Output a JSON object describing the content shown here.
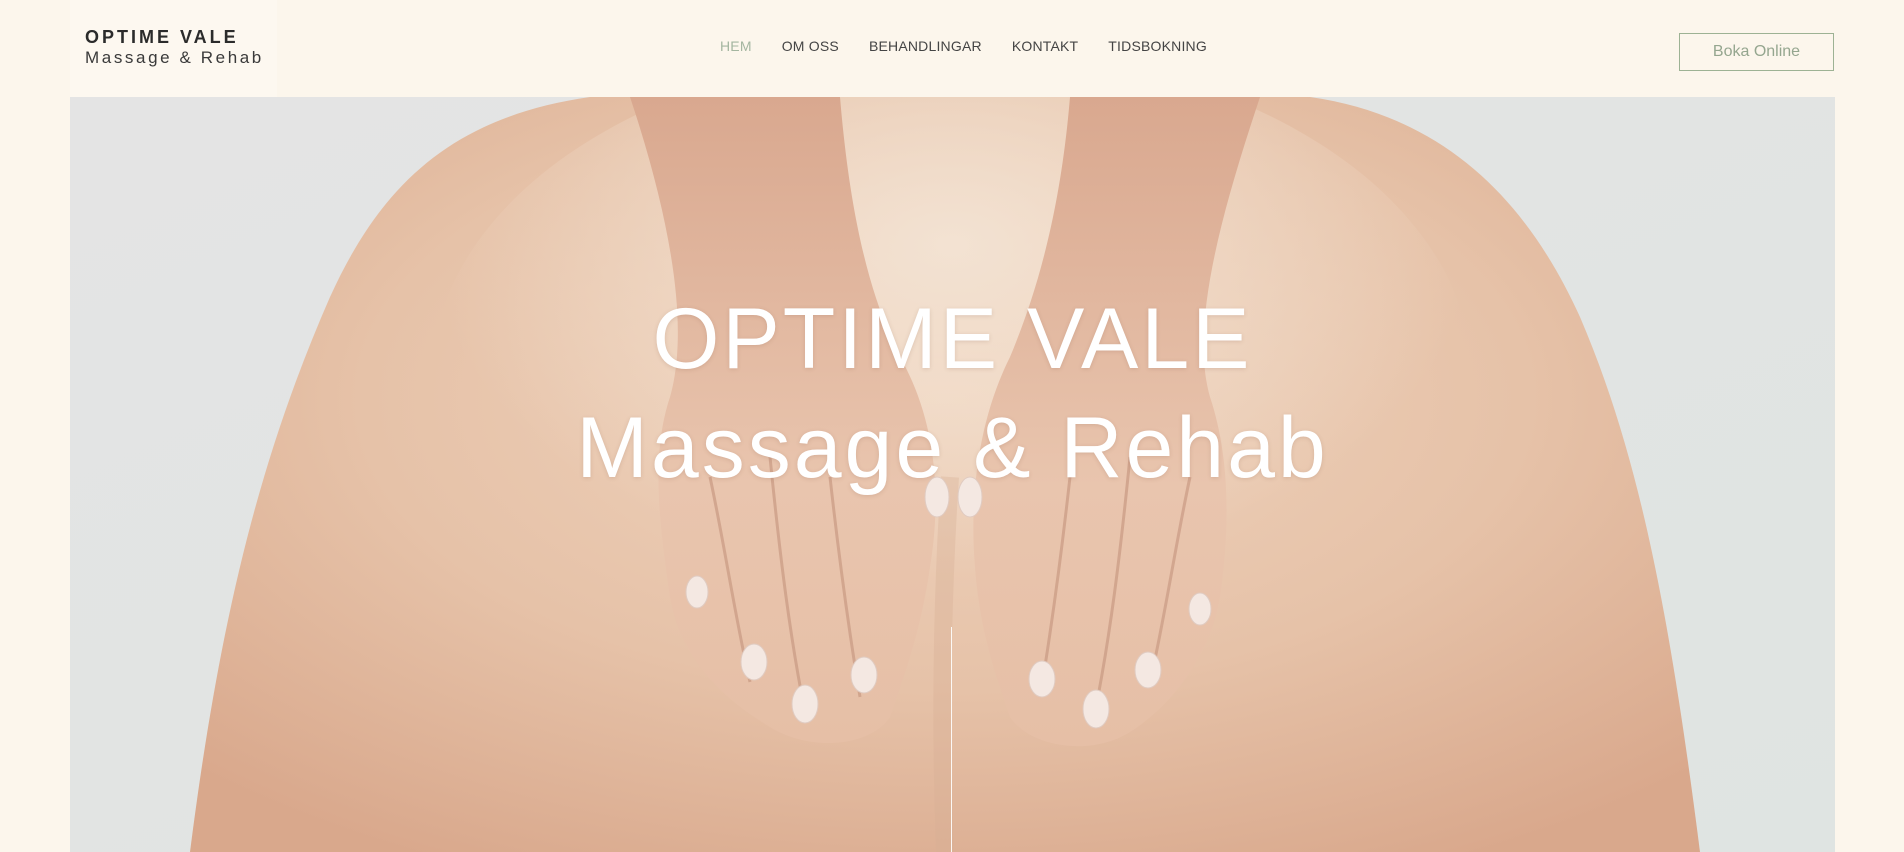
{
  "brand": {
    "name_line1": "OPTIME VALE",
    "name_line2": "Massage & Rehab"
  },
  "nav": {
    "items": [
      {
        "label": "HEM",
        "active": true
      },
      {
        "label": "OM OSS",
        "active": false
      },
      {
        "label": "BEHANDLINGAR",
        "active": false
      },
      {
        "label": "KONTAKT",
        "active": false
      },
      {
        "label": "TIDSBOKNING",
        "active": false
      }
    ]
  },
  "cta": {
    "label": "Boka Online"
  },
  "hero": {
    "title_line1": "OPTIME VALE",
    "title_line2": "Massage & Rehab",
    "image": "massage-hands-on-back-photo"
  },
  "colors": {
    "page_background": "#fcf6ec",
    "accent_green": "#9db294",
    "nav_active": "#a4b6a0",
    "text_dark": "#2b2b2b"
  }
}
